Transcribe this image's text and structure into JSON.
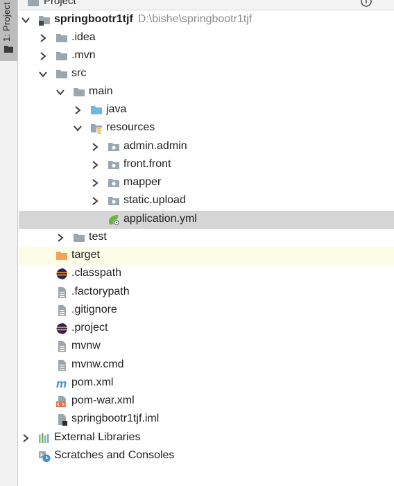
{
  "tool_window": {
    "stripe_label": "1: Project",
    "header_title": "Project"
  },
  "tree": {
    "rows": [
      {
        "label": "springbootr1tjf",
        "path": "D:\\bishe\\springbootr1tjf"
      },
      {
        "label": ".idea"
      },
      {
        "label": ".mvn"
      },
      {
        "label": "src"
      },
      {
        "label": "main"
      },
      {
        "label": "java"
      },
      {
        "label": "resources"
      },
      {
        "label": "admin.admin"
      },
      {
        "label": "front.front"
      },
      {
        "label": "mapper"
      },
      {
        "label": "static.upload"
      },
      {
        "label": "application.yml"
      },
      {
        "label": "test"
      },
      {
        "label": "target"
      },
      {
        "label": ".classpath"
      },
      {
        "label": ".factorypath"
      },
      {
        "label": ".gitignore"
      },
      {
        "label": ".project"
      },
      {
        "label": "mvnw"
      },
      {
        "label": "mvnw.cmd"
      },
      {
        "label": "pom.xml"
      },
      {
        "label": "pom-war.xml"
      },
      {
        "label": "springbootr1tjf.iml"
      },
      {
        "label": "External Libraries"
      },
      {
        "label": "Scratches and Consoles"
      }
    ]
  },
  "colors": {
    "folder": "#9aa7b0",
    "source_folder": "#6cb6e8",
    "excluded_folder": "#f3a35c",
    "selection": "#d5d5d5",
    "highlight_row": "#fcfce7",
    "maven": "#3b8fd6"
  }
}
